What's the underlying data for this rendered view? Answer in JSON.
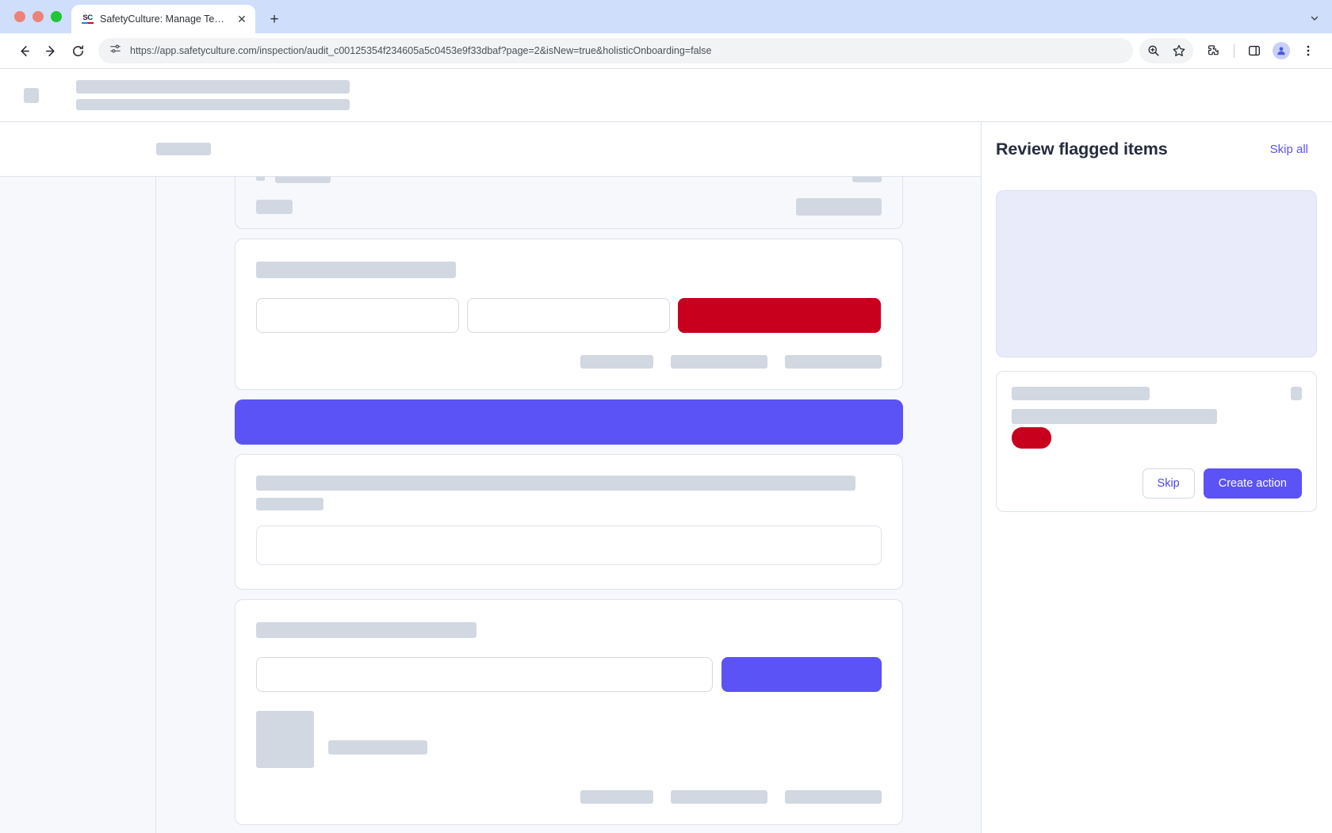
{
  "browser": {
    "window_controls": [
      "close",
      "minimize",
      "zoom"
    ],
    "tab": {
      "title": "SafetyCulture: Manage Teams and...",
      "favicon_text": "SC",
      "close_label": "✕"
    },
    "new_tab_label": "+",
    "tabstrip_chevron": "⌄",
    "toolbar": {
      "back_label": "Back",
      "forward_label": "Forward",
      "reload_label": "Reload",
      "site_info_label": "Site information",
      "url": "https://app.safetyculture.com/inspection/audit_c00125354f234605a5c0453e9f33dbaf?page=2&isNew=true&holisticOnboarding=false",
      "zoom_icon": "search-plus-icon",
      "bookmark_icon": "star-icon",
      "extensions_icon": "puzzle-icon",
      "side_panel_icon": "side-panel-icon",
      "profile_icon": "profile-avatar-icon",
      "menu_icon": "three-dot-menu-icon"
    }
  },
  "sidebar": {
    "title": "Review flagged items",
    "skip_all_label": "Skip all",
    "flagged_card": {
      "skip_label": "Skip",
      "create_action_label": "Create action"
    }
  },
  "colors": {
    "accent_purple": "#5b53f5",
    "flag_red": "#c8001e",
    "skeleton_gray": "#d2d8e1",
    "preview_lavender": "#e9ebfa",
    "page_bg": "#f7f8fb",
    "border": "#dee2ec",
    "tabstrip_blue": "#cfdefb"
  }
}
